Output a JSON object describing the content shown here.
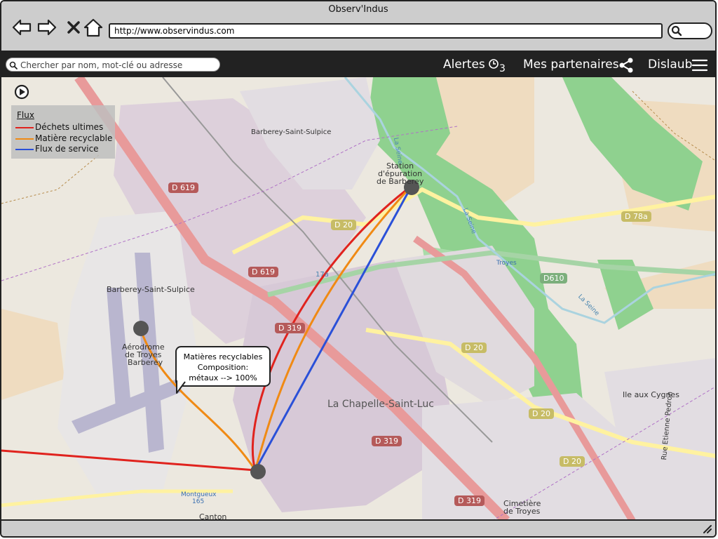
{
  "window": {
    "title": "Observ'Indus"
  },
  "browser": {
    "url": "http://www.observindus.com"
  },
  "appbar": {
    "search_placeholder": "Chercher par nom, mot-clé ou adresse",
    "alerts_label": "Alertes",
    "alerts_count": "3",
    "partners_label": "Mes partenaires",
    "user_label": "Dislaub"
  },
  "legend": {
    "title": "Flux",
    "items": [
      {
        "label": "Déchets ultimes",
        "color": "#e0231e"
      },
      {
        "label": "Matière recyclable",
        "color": "#f08a14"
      },
      {
        "label": "Flux de service",
        "color": "#2a50d8"
      }
    ]
  },
  "tooltip": {
    "line1": "Matières recyclables",
    "line2": "Composition:",
    "line3": "métaux --> 100%"
  },
  "map": {
    "places": {
      "barberey_top": "Barberey-Saint-Sulpice",
      "station_1": "Station",
      "station_2": "d'épuration",
      "station_3": "de Barberey",
      "barberey_left": "Barberey-Saint-Sulpice",
      "aero_1": "Aérodrome",
      "aero_2": "de Troyes",
      "aero_3": "Barberey",
      "chapelle": "La Chapelle-Saint-Luc",
      "cimetiere_1": "Cimetière",
      "cimetiere_2": "de Troyes",
      "ile": "Ile aux Cygnes",
      "troyes": "Troyes",
      "canton": "Canton",
      "montgueux": "Montgueux",
      "montgueux_num": "165",
      "rue": "Rue Etienne Pedron",
      "seine_1": "La Seine",
      "seine_2": "La Seine",
      "seine_3": "La Seine"
    },
    "roads": {
      "d619_a": "D 619",
      "d619_b": "D 619",
      "d20_a": "D 20",
      "d20_b": "D 20",
      "d20_c": "D 20",
      "d20_d": "D 20",
      "d319_a": "D 319",
      "d319_b": "D 319",
      "d319_c": "D 319",
      "d610": "D610",
      "d78a": "D 78a",
      "n17": "17a"
    }
  },
  "colors": {
    "dechets": "#e0231e",
    "recyclable": "#f08a14",
    "service": "#2a50d8",
    "node": "#555555",
    "forest": "#8fd18f",
    "urban": "#d7c9d7",
    "farmland": "#efdcc0"
  }
}
